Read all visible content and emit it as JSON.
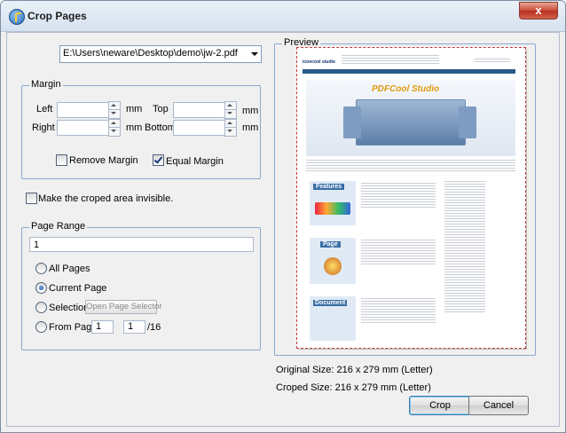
{
  "window": {
    "title": "Crop Pages",
    "close_label": "x"
  },
  "file": {
    "path": "E:\\Users\\neware\\Desktop\\demo\\jw-2.pdf"
  },
  "margin": {
    "legend": "Margin",
    "left_label": "Left",
    "right_label": "Right",
    "top_label": "Top",
    "bottom_label": "Bottom",
    "unit": "mm",
    "left_value": "",
    "right_value": "",
    "top_value": "",
    "bottom_value": "",
    "remove_margin_label": "Remove Margin",
    "remove_margin_checked": false,
    "equal_margin_label": "Equal Margin",
    "equal_margin_checked": true
  },
  "invisible": {
    "label": "Make the croped area invisible.",
    "checked": false
  },
  "page_range": {
    "legend": "Page Range",
    "value": "1",
    "all_pages_label": "All Pages",
    "current_page_label": "Current Page",
    "selection_label": "Selection",
    "open_selector_label": "Open Page Selector",
    "from_page_label": "From Page",
    "from_value": "1",
    "to_value": "1",
    "total": "/16",
    "selected": "current_page"
  },
  "preview": {
    "legend": "Preview",
    "brand": "iconcool studio",
    "banner": "PDFCool Studio",
    "section1": "Features",
    "section2": "Page",
    "section3": "Document"
  },
  "sizes": {
    "original": "Original Size: 216 x 279 mm (Letter)",
    "croped": "Croped Size: 216 x 279 mm (Letter)"
  },
  "buttons": {
    "crop": "Crop",
    "cancel": "Cancel"
  },
  "colors": {
    "accent": "#3c7fb1",
    "group_border": "#8aa8cf",
    "preview_border": "#c53a3a"
  }
}
